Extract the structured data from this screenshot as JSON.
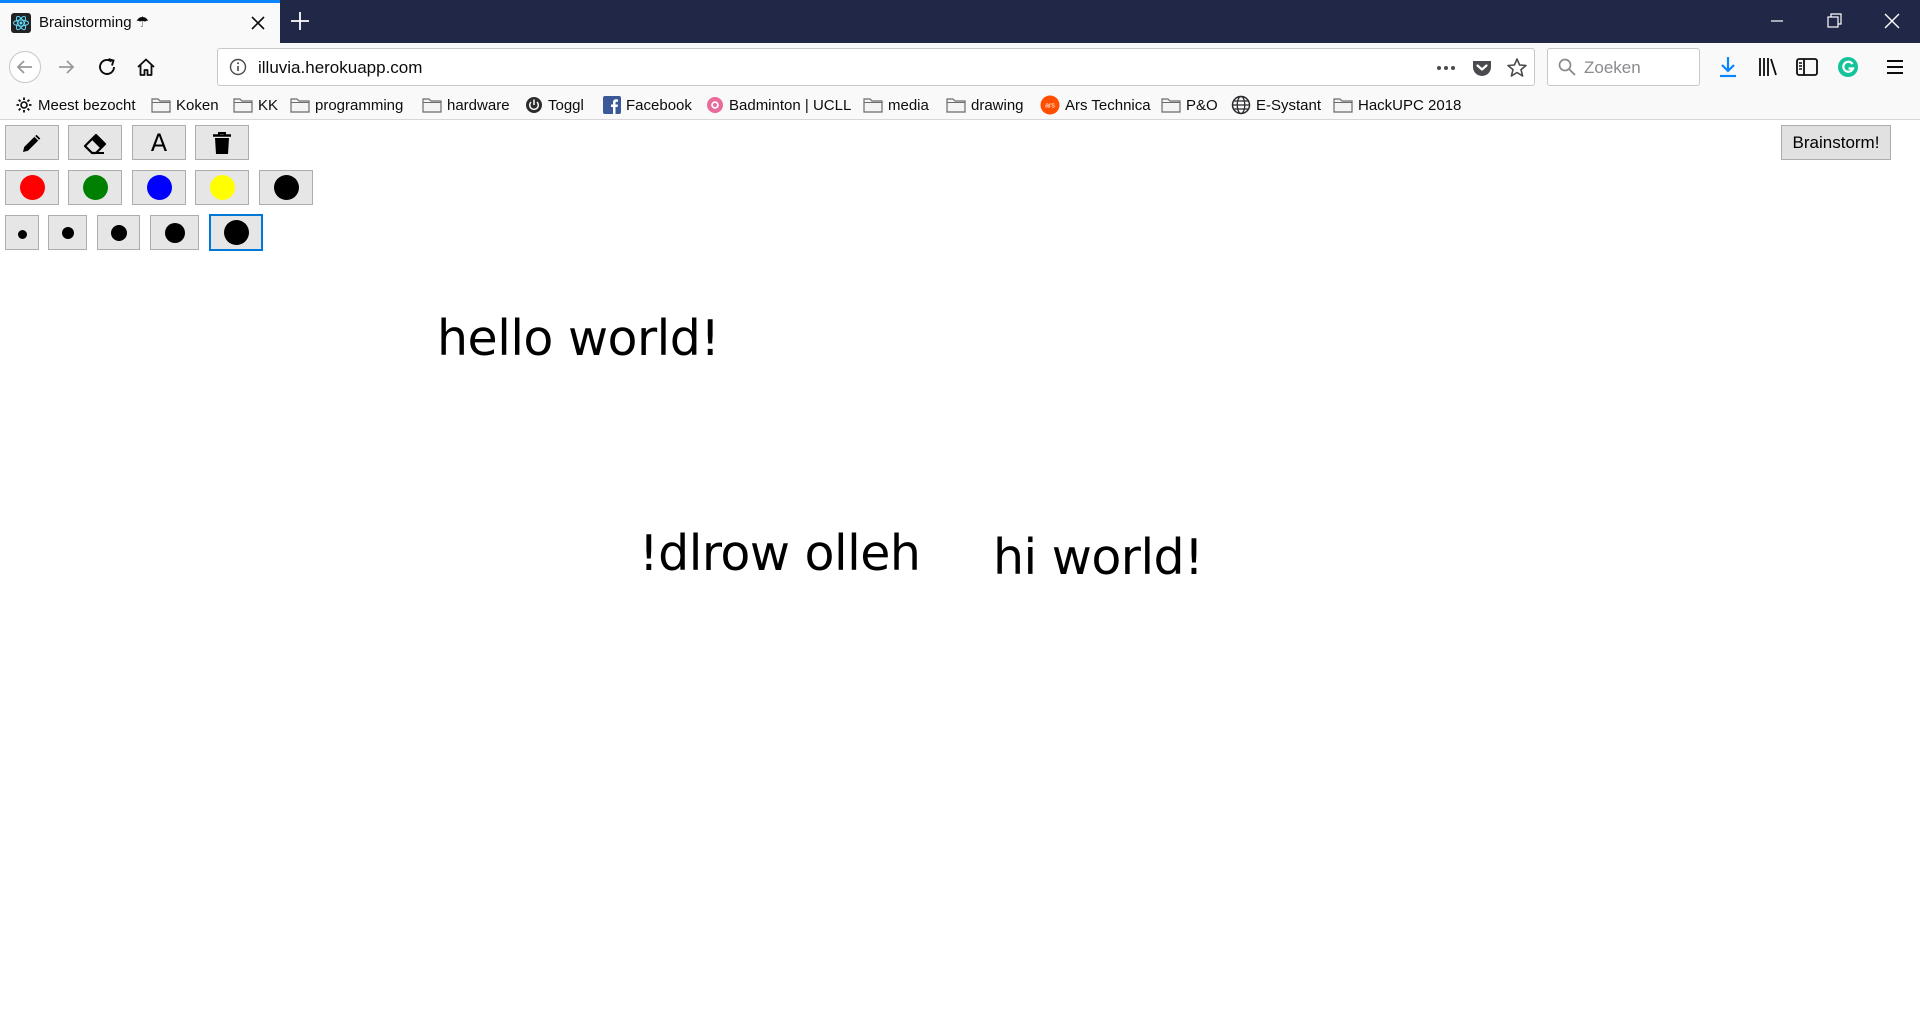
{
  "browser": {
    "tab": {
      "title": "Brainstorming ☂"
    },
    "url": "illuvia.herokuapp.com",
    "search": {
      "placeholder": "Zoeken"
    },
    "bookmarks": [
      {
        "label": "Meest bezocht",
        "icon": "gear-icon"
      },
      {
        "label": "Koken",
        "icon": "folder-icon"
      },
      {
        "label": "KK",
        "icon": "folder-icon"
      },
      {
        "label": "programming",
        "icon": "folder-icon"
      },
      {
        "label": "hardware",
        "icon": "folder-icon"
      },
      {
        "label": "Toggl",
        "icon": "toggl-icon"
      },
      {
        "label": "Facebook",
        "icon": "facebook-icon"
      },
      {
        "label": "Badminton | UCLL",
        "icon": "badminton-icon"
      },
      {
        "label": "media",
        "icon": "folder-icon"
      },
      {
        "label": "drawing",
        "icon": "folder-icon"
      },
      {
        "label": "Ars Technica",
        "icon": "ars-icon",
        "icon_text": "ars"
      },
      {
        "label": "P&O",
        "icon": "folder-icon"
      },
      {
        "label": "E-Systant",
        "icon": "globe-icon"
      },
      {
        "label": "HackUPC 2018",
        "icon": "folder-icon"
      }
    ]
  },
  "app": {
    "tools": [
      {
        "name": "pencil",
        "icon": "pencil-icon"
      },
      {
        "name": "eraser",
        "icon": "eraser-icon"
      },
      {
        "name": "text",
        "icon": "text-tool-icon",
        "glyph": "A"
      },
      {
        "name": "delete",
        "icon": "trash-icon"
      }
    ],
    "colors": [
      {
        "name": "red",
        "hex": "#ff0000"
      },
      {
        "name": "green",
        "hex": "#008000"
      },
      {
        "name": "blue",
        "hex": "#0000ff"
      },
      {
        "name": "yellow",
        "hex": "#ffff00"
      },
      {
        "name": "black",
        "hex": "#000000"
      }
    ],
    "sizes": {
      "count": 5,
      "selected_index": 4
    },
    "brainstorm_label": "Brainstorm!",
    "notes": [
      "hello world!",
      "!dlrow olleh",
      "hi world!"
    ]
  },
  "colors": {
    "accent": "#0a84ff",
    "titlebar": "#212746",
    "selected_border": "#0078d7"
  }
}
